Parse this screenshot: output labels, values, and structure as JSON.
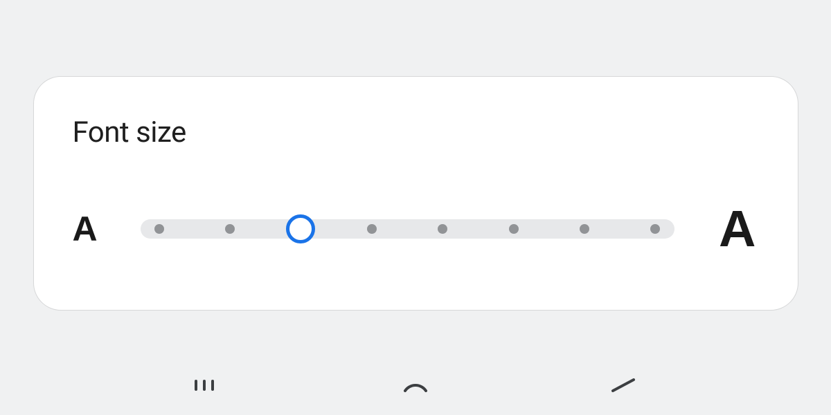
{
  "card": {
    "title": "Font size"
  },
  "slider": {
    "small_label": "A",
    "large_label": "A",
    "steps": 8,
    "selected_index": 2,
    "accent_color": "#1a73e8",
    "tick_color": "#919396",
    "track_color": "#e7e8ea"
  }
}
